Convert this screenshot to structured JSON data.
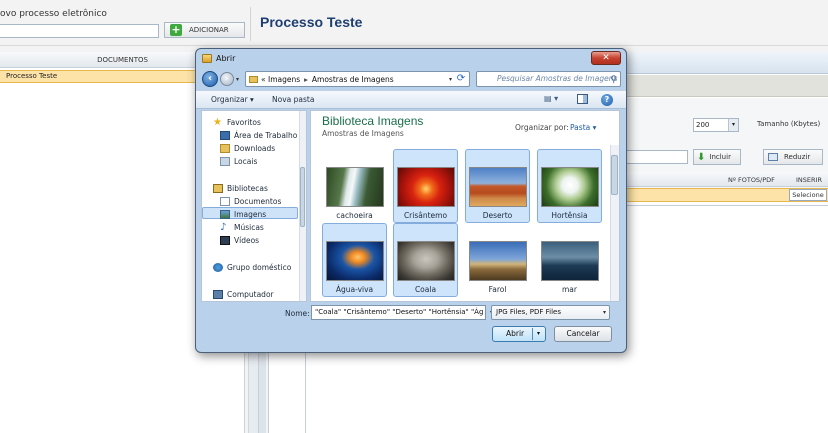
{
  "app": {
    "new_process_label": "ovo processo eletrônico",
    "add_button": "ADICIONAR",
    "page_title": "Processo Teste",
    "documents_header": "DOCUMENTOS",
    "document_row": "Processo Teste",
    "size_value": "200",
    "size_label": "Tamanho (Kbytes)",
    "include_button": "Incluir",
    "reduce_button": "Reduzir",
    "grid_columns": [
      "Nº FOTOS/PDF",
      "INSERIR"
    ],
    "select_button": "Selecione"
  },
  "dialog": {
    "title": "Abrir",
    "close_glyph": "✕",
    "address": {
      "prefix": "«",
      "crumbs": [
        "Imagens",
        "Amostras de Imagens"
      ]
    },
    "search_placeholder": "Pesquisar Amostras de Imagens",
    "toolbar": {
      "organize": "Organizar ▾",
      "new_folder": "Nova pasta"
    },
    "nav": {
      "favorites": "Favoritos",
      "desktop": "Área de Trabalho",
      "downloads": "Downloads",
      "places": "Locais",
      "libraries": "Bibliotecas",
      "documents": "Documentos",
      "images": "Imagens",
      "music": "Músicas",
      "videos": "Vídeos",
      "homegroup": "Grupo doméstico",
      "computer": "Computador"
    },
    "library": {
      "title": "Biblioteca Imagens",
      "subtitle": "Amostras de Imagens",
      "arrange_label": "Organizar por:",
      "arrange_value": "Pasta ▾"
    },
    "files": [
      {
        "name": "cachoeira",
        "selected": false
      },
      {
        "name": "Crisântemo",
        "selected": true
      },
      {
        "name": "Deserto",
        "selected": true
      },
      {
        "name": "Hortênsia",
        "selected": true
      },
      {
        "name": "Água-viva",
        "selected": true
      },
      {
        "name": "Coala",
        "selected": true
      },
      {
        "name": "Farol",
        "selected": false
      },
      {
        "name": "mar",
        "selected": false
      }
    ],
    "name_label": "Nome:",
    "name_value": "\"Coala\" \"Crisântemo\" \"Deserto\" \"Hortênsia\" \"Ág",
    "filter_value": "JPG Files, PDF Files",
    "open_button": "Abrir",
    "cancel_button": "Cancelar"
  },
  "icons": {
    "back": "back-arrow-icon",
    "forward": "forward-arrow-icon",
    "refresh": "refresh-icon",
    "search": "search-icon",
    "help": "help-icon"
  },
  "colors": {
    "selection_row": "#fde3a7",
    "dialog_frame": "#b9d1ea",
    "library_title": "#1a6f4a",
    "page_title": "#1f3f73"
  }
}
